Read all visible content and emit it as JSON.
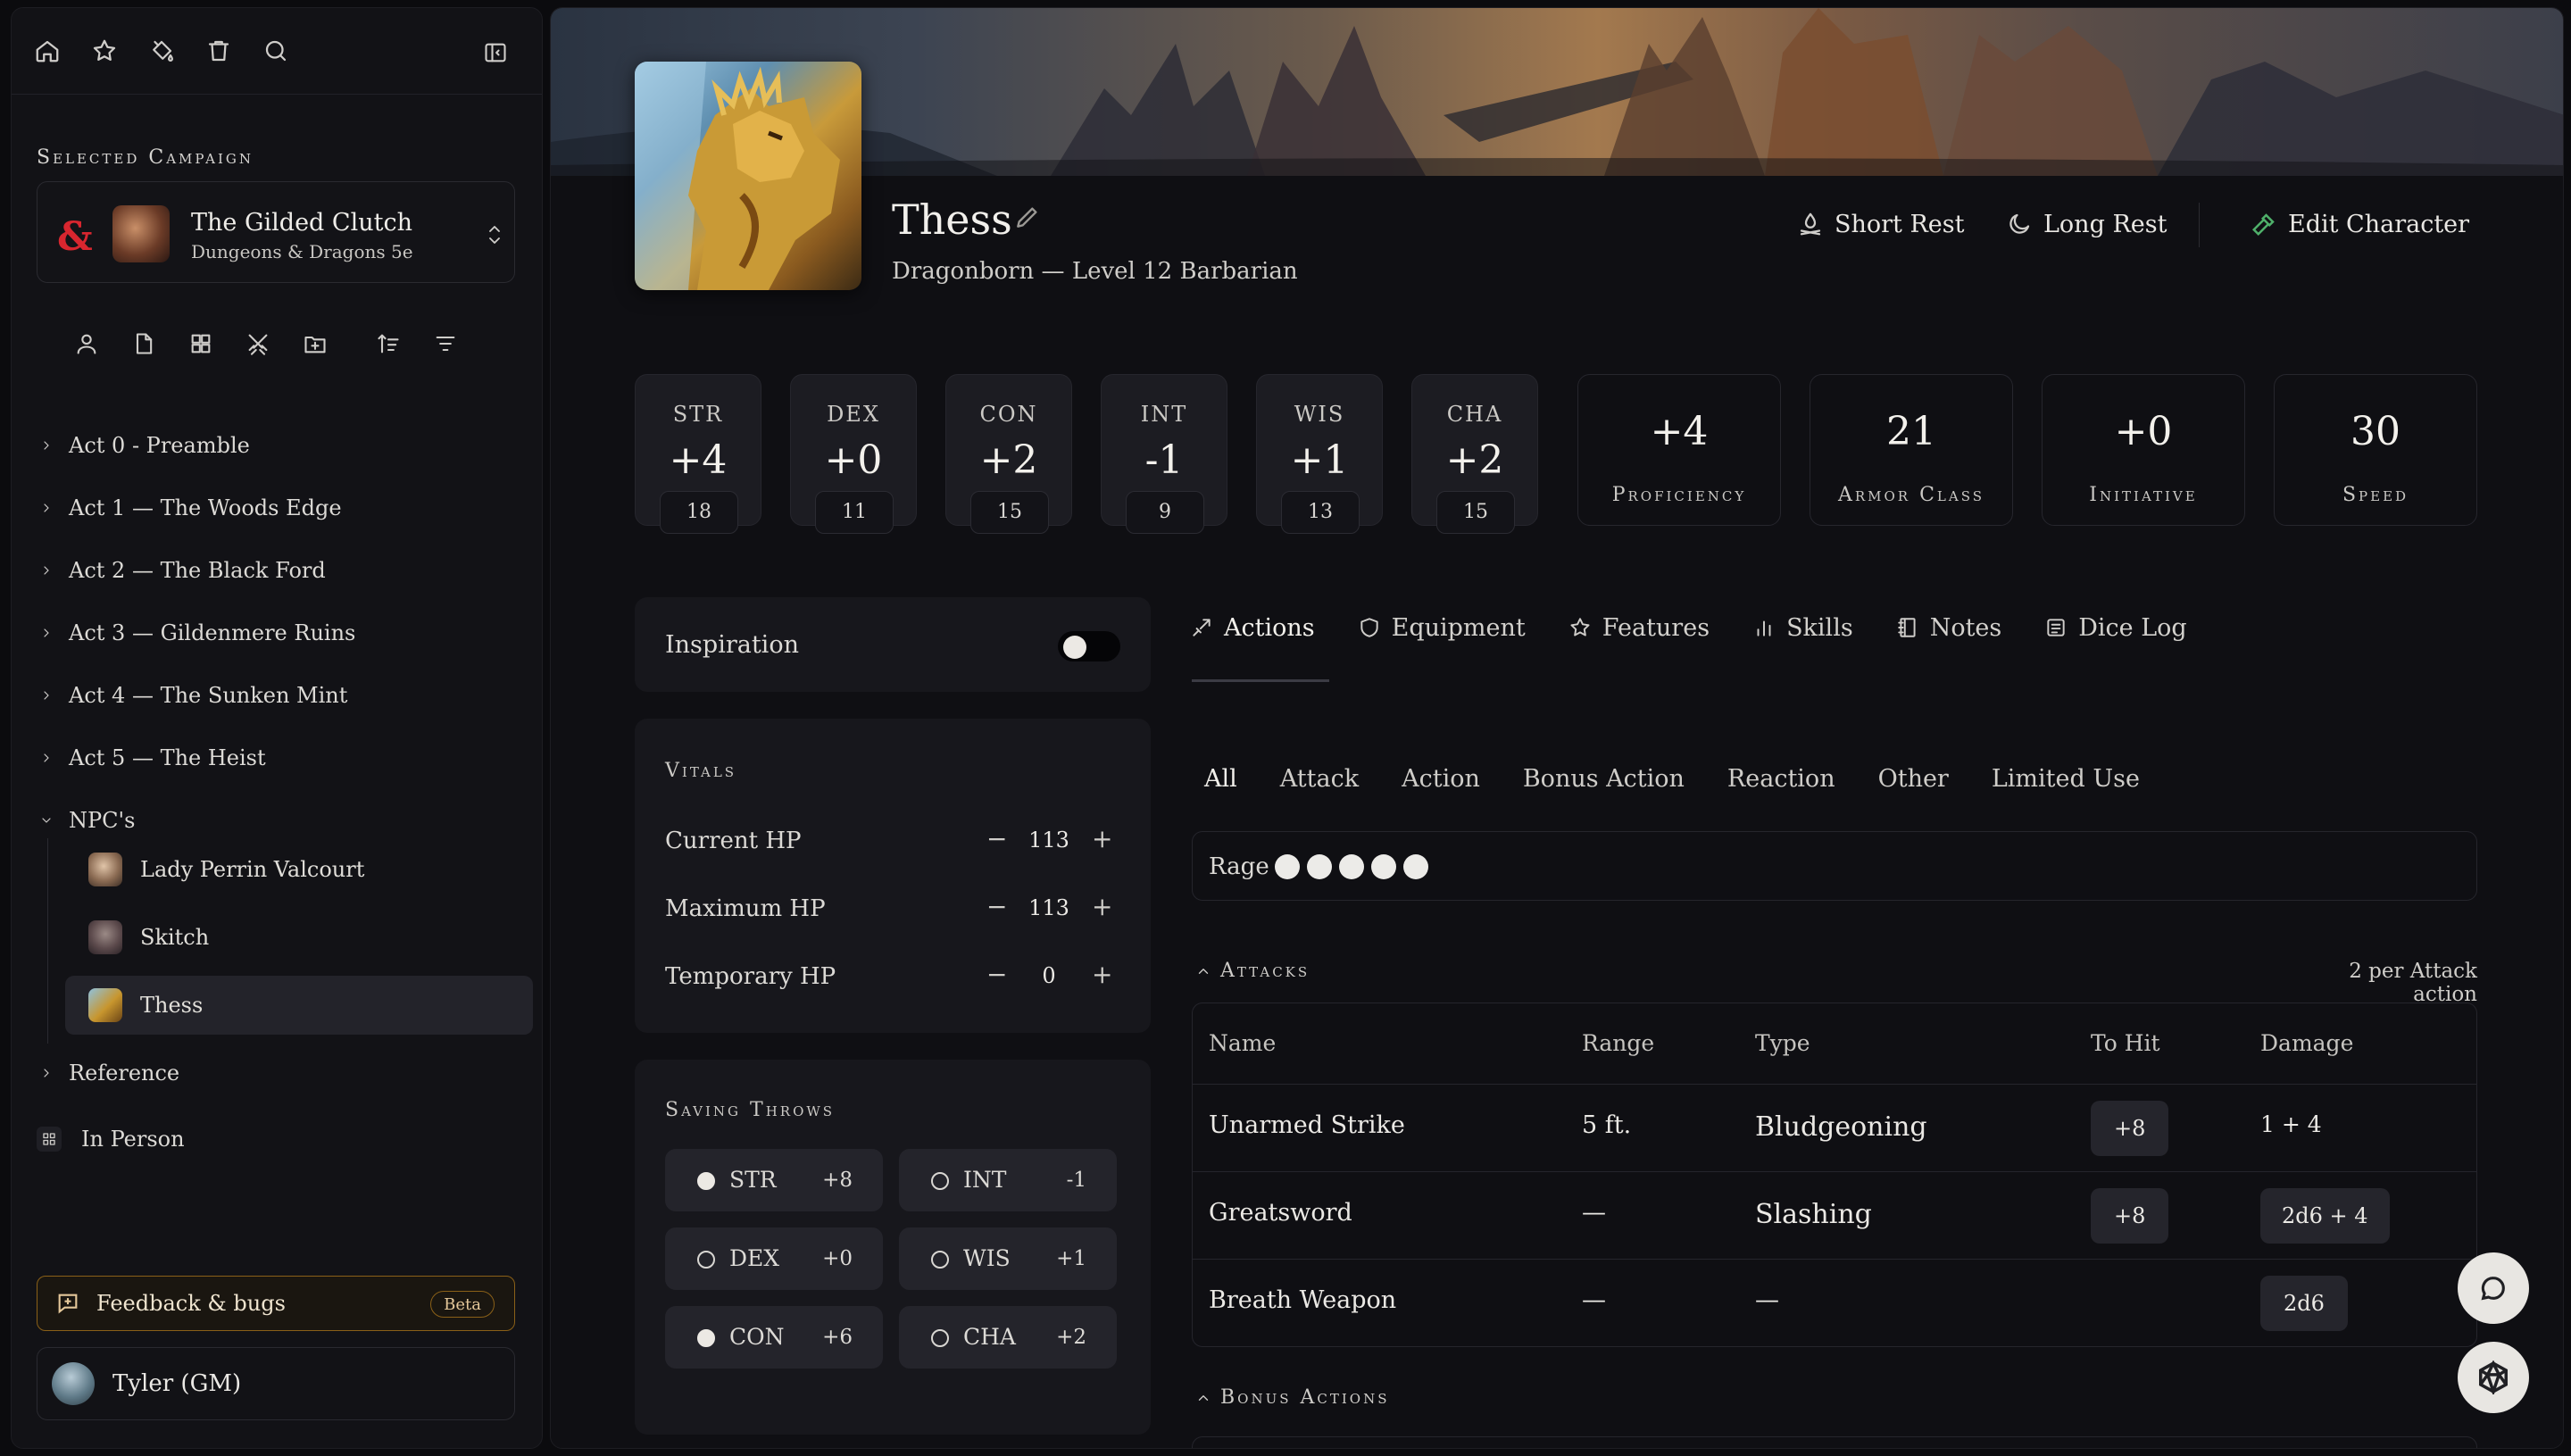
{
  "sidebar": {
    "section_label": "Selected Campaign",
    "campaign": {
      "title": "The Gilded Clutch",
      "system": "Dungeons & Dragons 5e",
      "logo_text": "&"
    },
    "tree": [
      {
        "label": "Act 0 - Preamble"
      },
      {
        "label": "Act 1 — The Woods Edge"
      },
      {
        "label": "Act 2 — The Black Ford"
      },
      {
        "label": "Act 3 — Gildenmere Ruins"
      },
      {
        "label": "Act 4 — The Sunken Mint"
      },
      {
        "label": "Act 5 — The Heist"
      },
      {
        "label": "NPC's"
      }
    ],
    "npcs": [
      {
        "label": "Lady Perrin Valcourt"
      },
      {
        "label": "Skitch"
      },
      {
        "label": "Thess"
      }
    ],
    "reference": "Reference",
    "in_person": "In Person",
    "feedback": {
      "label": "Feedback & bugs",
      "badge": "Beta"
    },
    "user": "Tyler (GM)"
  },
  "character": {
    "name": "Thess",
    "subtitle": "Dragonborn — Level 12 Barbarian",
    "actions": {
      "short_rest": "Short Rest",
      "long_rest": "Long Rest",
      "edit": "Edit Character"
    }
  },
  "abilities": [
    {
      "label": "STR",
      "mod": "+4",
      "score": "18"
    },
    {
      "label": "DEX",
      "mod": "+0",
      "score": "11"
    },
    {
      "label": "CON",
      "mod": "+2",
      "score": "15"
    },
    {
      "label": "INT",
      "mod": "-1",
      "score": "9"
    },
    {
      "label": "WIS",
      "mod": "+1",
      "score": "13"
    },
    {
      "label": "CHA",
      "mod": "+2",
      "score": "15"
    }
  ],
  "summary": [
    {
      "value": "+4",
      "label": "Proficiency"
    },
    {
      "value": "21",
      "label": "Armor Class"
    },
    {
      "value": "+0",
      "label": "Initiative"
    },
    {
      "value": "30",
      "label": "Speed"
    }
  ],
  "inspiration": {
    "label": "Inspiration",
    "on": false
  },
  "vitals": {
    "title": "Vitals",
    "rows": [
      {
        "label": "Current HP",
        "value": "113"
      },
      {
        "label": "Maximum HP",
        "value": "113"
      },
      {
        "label": "Temporary HP",
        "value": "0"
      }
    ],
    "minus": "−",
    "plus": "+"
  },
  "saving_throws": {
    "title": "Saving Throws",
    "items": [
      {
        "label": "STR",
        "bonus": "+8",
        "proficient": true
      },
      {
        "label": "INT",
        "bonus": "-1",
        "proficient": false
      },
      {
        "label": "DEX",
        "bonus": "+0",
        "proficient": false
      },
      {
        "label": "WIS",
        "bonus": "+1",
        "proficient": false
      },
      {
        "label": "CON",
        "bonus": "+6",
        "proficient": true
      },
      {
        "label": "CHA",
        "bonus": "+2",
        "proficient": false
      }
    ]
  },
  "tabs": [
    "Actions",
    "Equipment",
    "Features",
    "Skills",
    "Notes",
    "Dice Log"
  ],
  "subtabs": [
    "All",
    "Attack",
    "Action",
    "Bonus Action",
    "Reaction",
    "Other",
    "Limited Use"
  ],
  "rage": {
    "label": "Rage",
    "charges": 5
  },
  "attacks": {
    "title": "Attacks",
    "note": "2 per Attack action",
    "headers": [
      "Name",
      "Range",
      "Type",
      "To Hit",
      "Damage"
    ],
    "rows": [
      {
        "name": "Unarmed Strike",
        "range": "5 ft.",
        "type": "Bludgeoning",
        "to_hit": "+8",
        "damage": "1 + 4"
      },
      {
        "name": "Greatsword",
        "range": "—",
        "type": "Slashing",
        "to_hit": "+8",
        "damage": "2d6 + 4"
      },
      {
        "name": "Breath Weapon",
        "range": "—",
        "type": "—",
        "to_hit": "",
        "damage": "2d6"
      }
    ]
  },
  "bonus_actions": {
    "title": "Bonus Actions"
  },
  "colors": {
    "accent_green": "#4fb06a",
    "feedback_border": "#8a6018",
    "background": "#0b0b0e"
  }
}
